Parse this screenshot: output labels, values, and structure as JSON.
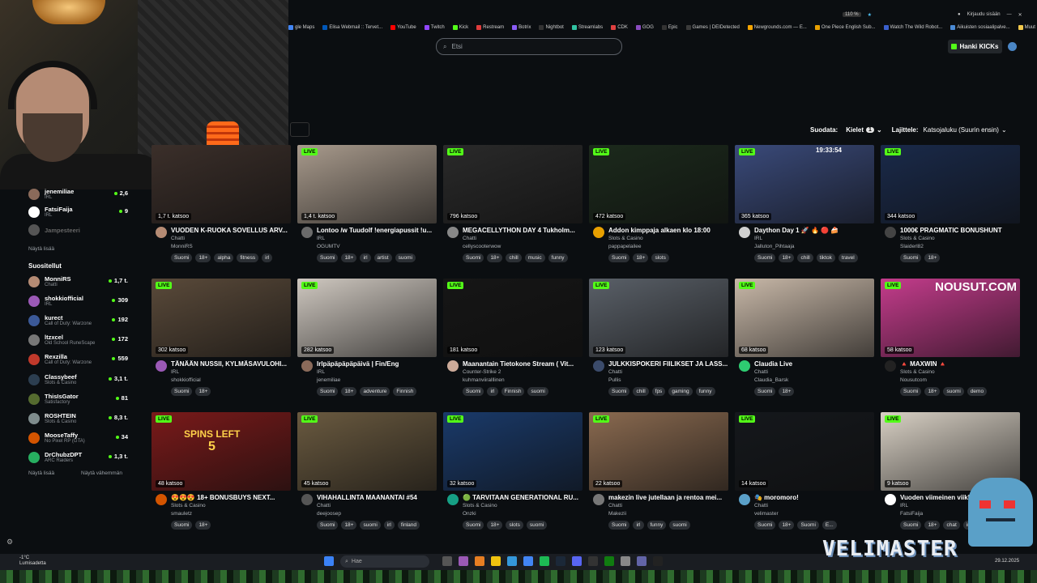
{
  "browser": {
    "zoom": "110 %",
    "login": "Kirjaudu sisään",
    "bookmarks": [
      "gle Maps",
      "Elisa Webmail :: Tervet...",
      "YouTube",
      "Twitch",
      "Kick",
      "Restream",
      "Botrix",
      "Nightbot",
      "Streamlabs",
      "CDK",
      "GOG",
      "Epic",
      "Games | DEIDetected",
      "Newgrounds.com — E...",
      "One Piece English Sub...",
      "Watch The Wild Robot...",
      "Aikuisten sosiaalipalve...",
      "Muut kirjanmerkit"
    ],
    "bookmark_colors": [
      "#4285f4",
      "#0057b8",
      "#ff0000",
      "#9146ff",
      "#53fc18",
      "#e03c3c",
      "#8a5cf6",
      "#333333",
      "#31c3a2",
      "#e04040",
      "#8a4cc0",
      "#333333",
      "#3a3a3a",
      "#f7a500",
      "#e8a000",
      "#3a5fcd",
      "#4a8ad4",
      "#f2c94c"
    ]
  },
  "header": {
    "search_placeholder": "Etsi",
    "kicks_label": "Hanki KICKs"
  },
  "sortbar": {
    "sort_label": "Suodata:",
    "languages_label": "Kielet",
    "languages_count": "1",
    "order_label": "Lajittele:",
    "order_value": "Katsojaluku (Suurin ensin)"
  },
  "sidebar": {
    "top_items": [
      {
        "name": "jenemiliae",
        "category": "IRL",
        "count": "2,6",
        "color": "#8a6a5a"
      },
      {
        "name": "FatsiFaija",
        "category": "IRL",
        "count": "9",
        "color": "#ffffff"
      },
      {
        "name": "Jampesteeri",
        "category": "",
        "count": "",
        "color": "#555555"
      }
    ],
    "show_more_top": "Näytä lisää",
    "recommended_heading": "Suositellut",
    "recommended": [
      {
        "name": "MonniRS",
        "category": "Chatti",
        "count": "1,7 t.",
        "color": "#b58b74"
      },
      {
        "name": "shokkiofficial",
        "category": "IRL",
        "count": "309",
        "color": "#9b59b6"
      },
      {
        "name": "kurect",
        "category": "Call of Duty: Warzone",
        "count": "192",
        "color": "#3b5998"
      },
      {
        "name": "ltzxcel",
        "category": "Old School RuneScape",
        "count": "172",
        "color": "#777777"
      },
      {
        "name": "Rexzilla",
        "category": "Call of Duty: Warzone",
        "count": "559",
        "color": "#c0392b"
      },
      {
        "name": "Classybeef",
        "category": "Slots & Casino",
        "count": "3,1 t.",
        "color": "#2c3e50"
      },
      {
        "name": "ThisIsGator",
        "category": "Satisfactory",
        "count": "81",
        "color": "#556b2f"
      },
      {
        "name": "ROSHTEIN",
        "category": "Slots & Casino",
        "count": "8,3 t.",
        "color": "#7f8c8d"
      },
      {
        "name": "MooseTaffy",
        "category": "No Pixel RP (GTA)",
        "count": "34",
        "color": "#d35400"
      },
      {
        "name": "DrChubzDPT",
        "category": "ARC Raiders",
        "count": "1,3 t.",
        "color": "#27ae60"
      }
    ],
    "show_more": "Näytä lisää",
    "show_less": "Näytä vähemmän"
  },
  "live_label": "LIVE",
  "streams": [
    {
      "viewers": "1,7 t. katsoo",
      "title": "VUODEN K-RUOKA SOVELLUS ARV...",
      "category": "Chatti",
      "user": "MonniRS",
      "tags": [
        "Suomi",
        "18+",
        "alpha",
        "fitness",
        "irl"
      ],
      "thumb": "#3b2f2a",
      "av": "#b58b74"
    },
    {
      "viewers": "1,4 t. katsoo",
      "title": "Lontoo /w Tuudolf !energiapussit !u...",
      "category": "IRL",
      "user": "OGUMTV",
      "tags": [
        "Suomi",
        "18+",
        "irl",
        "artist",
        "suomi"
      ],
      "thumb": "#a89a8c",
      "av": "#6b6b6b"
    },
    {
      "viewers": "796 katsoo",
      "title": "MEGACELLYTHON DAY 4 Tukholm...",
      "category": "Chatti",
      "user": "cellyscooterwow",
      "tags": [
        "Suomi",
        "18+",
        "chill",
        "music",
        "funny"
      ],
      "thumb": "#2a2a2a",
      "av": "#888888"
    },
    {
      "viewers": "472 katsoo",
      "title": "Addon kimppaja alkaen klo 18:00",
      "category": "Slots & Casino",
      "user": "pappapelailee",
      "tags": [
        "Suomi",
        "18+",
        "slots"
      ],
      "thumb": "#1c2a1c",
      "av": "#e8a000"
    },
    {
      "viewers": "365 katsoo",
      "title": "Daython Day 1 🚀 🔥 🔴 🍰",
      "category": "IRL",
      "user": "Jalluton_Pihtaaja",
      "tags": [
        "Suomi",
        "18+",
        "chill",
        "tiktok",
        "travel"
      ],
      "thumb": "#3a4a7a",
      "av": "#d0d0d0"
    },
    {
      "viewers": "344 katsoo",
      "title": "1000€ PRAGMATIC BONUSHUNT",
      "category": "Slots & Casino",
      "user": "Slaiderl82",
      "tags": [
        "Suomi",
        "18+"
      ],
      "thumb": "#1a2a4a",
      "av": "#444444"
    },
    {
      "viewers": "302 katsoo",
      "title": "TÄNÄÄN NUSSII, KYLMÄSAVULOHI...",
      "category": "IRL",
      "user": "shokkiofficial",
      "tags": [
        "Suomi",
        "18+"
      ],
      "thumb": "#5a4a3a",
      "av": "#9b59b6"
    },
    {
      "viewers": "282 katsoo",
      "title": "Irlpäpäpäpäpäivä | Fin/Eng",
      "category": "IRL",
      "user": "jenemiliae",
      "tags": [
        "Suomi",
        "18+",
        "adventure",
        "Finnish"
      ],
      "thumb": "#cfc8c0",
      "av": "#8a6a5a"
    },
    {
      "viewers": "181 katsoo",
      "title": "Maanantain Tietokone Stream ( Vit...",
      "category": "Counter-Strike 2",
      "user": "kuhmanviiralllinen",
      "tags": [
        "Suomi",
        "irl",
        "Finnish",
        "suomi"
      ],
      "thumb": "#161616",
      "av": "#ccaa99"
    },
    {
      "viewers": "123 katsoo",
      "title": "JULKKISPOKERI FIILIKSET JA LASS...",
      "category": "Chatti",
      "user": "Pullis",
      "tags": [
        "Suomi",
        "chill",
        "fps",
        "gaming",
        "funny"
      ],
      "thumb": "#5a6068",
      "av": "#3b4b6b"
    },
    {
      "viewers": "68 katsoo",
      "title": "Claudia Live",
      "category": "Chatti",
      "user": "Claudia_Barsk",
      "tags": [
        "Suomi",
        "18+"
      ],
      "thumb": "#c8b8a8",
      "av": "#2ecc71"
    },
    {
      "viewers": "58 katsoo",
      "title": "🔺 MAXWIN 🔺",
      "category": "Slots & Casino",
      "user": "Nousutcom",
      "tags": [
        "Suomi",
        "18+",
        "suomi",
        "demo"
      ],
      "thumb": "#c43c8c",
      "av": "#222222"
    },
    {
      "viewers": "48 katsoo",
      "title": "😍😍😍 18+ BONUSBUYS NEXT...",
      "category": "Slots & Casino",
      "user": "smauletz",
      "tags": [
        "Suomi",
        "18+"
      ],
      "thumb": "#7a1a1a",
      "av": "#d35400"
    },
    {
      "viewers": "45 katsoo",
      "title": "VIHAHALLINTA MAANANTAI #54",
      "category": "Chatti",
      "user": "deejoosep",
      "tags": [
        "Suomi",
        "18+",
        "suomi",
        "irl",
        "finland"
      ],
      "thumb": "#6a5a40",
      "av": "#555555"
    },
    {
      "viewers": "32 katsoo",
      "title": "🟢 TARVITAAN GENERATIONAL RU...",
      "category": "Slots & Casino",
      "user": "Onzki",
      "tags": [
        "Suomi",
        "18+",
        "slots",
        "suomi"
      ],
      "thumb": "#1a3a6a",
      "av": "#16a085"
    },
    {
      "viewers": "22 katsoo",
      "title": "makezin live jutellaan ja rentoa mei...",
      "category": "Chatti",
      "user": "Makezii",
      "tags": [
        "Suomi",
        "irl",
        "funny",
        "suomi"
      ],
      "thumb": "#8a6a50",
      "av": "#777777"
    },
    {
      "viewers": "14 katsoo",
      "title": "🎭 moromoro!",
      "category": "Chatti",
      "user": "velimaster",
      "tags": [
        "Suomi",
        "18+",
        "Suomi",
        "E..."
      ],
      "thumb": "#15181c",
      "av": "#5aa0c8"
    },
    {
      "viewers": "9 katsoo",
      "title": "Vuoden viimeinen viikko",
      "category": "IRL",
      "user": "FatsiFaija",
      "tags": [
        "Suomi",
        "18+",
        "chat",
        "irl"
      ],
      "thumb": "#d8d0c4",
      "av": "#ffffff"
    }
  ],
  "nousut_text": "NOUSUT.COM",
  "spins_text": "SPINS LEFT",
  "spins_count": "5",
  "clock_overlay": "19:33:54",
  "taskbar": {
    "search_placeholder": "Hae",
    "weather_temp": "-1°C",
    "weather_desc": "Lumisadetta",
    "date": "29.12.2025"
  },
  "overlay_text": "VELIMASTER"
}
